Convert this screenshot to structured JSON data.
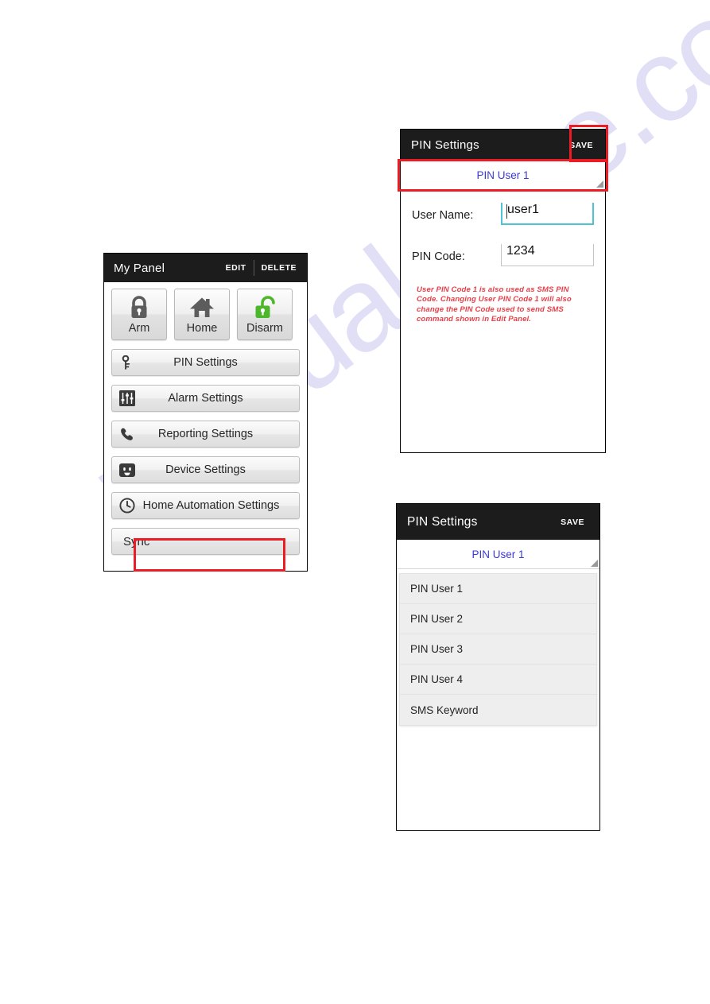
{
  "watermark": {
    "text": "manualshive.com"
  },
  "my_panel": {
    "header": {
      "title": "My Panel",
      "edit_label": "EDIT",
      "delete_label": "DELETE"
    },
    "modes": [
      {
        "label": "Arm",
        "icon": "lock-closed-icon",
        "state": "locked",
        "color": "#5c5c5c"
      },
      {
        "label": "Home",
        "icon": "house-icon",
        "state": "home",
        "color": "#5c5c5c"
      },
      {
        "label": "Disarm",
        "icon": "lock-open-icon",
        "state": "unlocked",
        "color": "#4cb72b"
      }
    ],
    "menu": [
      {
        "label": "PIN Settings",
        "icon": "key-icon"
      },
      {
        "label": "Alarm Settings",
        "icon": "sliders-icon"
      },
      {
        "label": "Reporting Settings",
        "icon": "phone-icon"
      },
      {
        "label": "Device Settings",
        "icon": "power-outlet-icon"
      },
      {
        "label": "Home Automation Settings",
        "icon": "clock-icon"
      },
      {
        "label": "Sync",
        "icon": "none",
        "highlighted": true
      }
    ]
  },
  "pin_form": {
    "header": {
      "title": "PIN Settings",
      "save_label": "SAVE"
    },
    "spinner": {
      "selected": "PIN User 1",
      "arrow_icon": "spinner-arrow-icon",
      "highlighted": true
    },
    "fields": [
      {
        "label": "User Name:",
        "value": "user1",
        "focused": true
      },
      {
        "label": "PIN Code:",
        "value": "1234",
        "focused": false
      }
    ],
    "warning": "User PIN Code 1 is also used as SMS PIN Code. Changing User PIN Code 1 will also change the PIN Code used to send SMS command shown in Edit Panel."
  },
  "pin_list": {
    "header": {
      "title": "PIN Settings",
      "save_label": "SAVE"
    },
    "spinner": {
      "selected": "PIN User 1",
      "arrow_icon": "spinner-arrow-icon"
    },
    "options": [
      {
        "label": "PIN User 1"
      },
      {
        "label": "PIN User 2"
      },
      {
        "label": "PIN User 3"
      },
      {
        "label": "PIN User 4"
      },
      {
        "label": "SMS Keyword"
      }
    ]
  },
  "colors": {
    "titlebar_bg": "#1c1c1c",
    "accent_blue": "#3b39d6",
    "highlight_red": "#ec1c24",
    "warning_red": "#e8404a",
    "focus_teal": "#4cc4d4",
    "disarm_green": "#4cb72b",
    "watermark": "#c9c6ef"
  }
}
